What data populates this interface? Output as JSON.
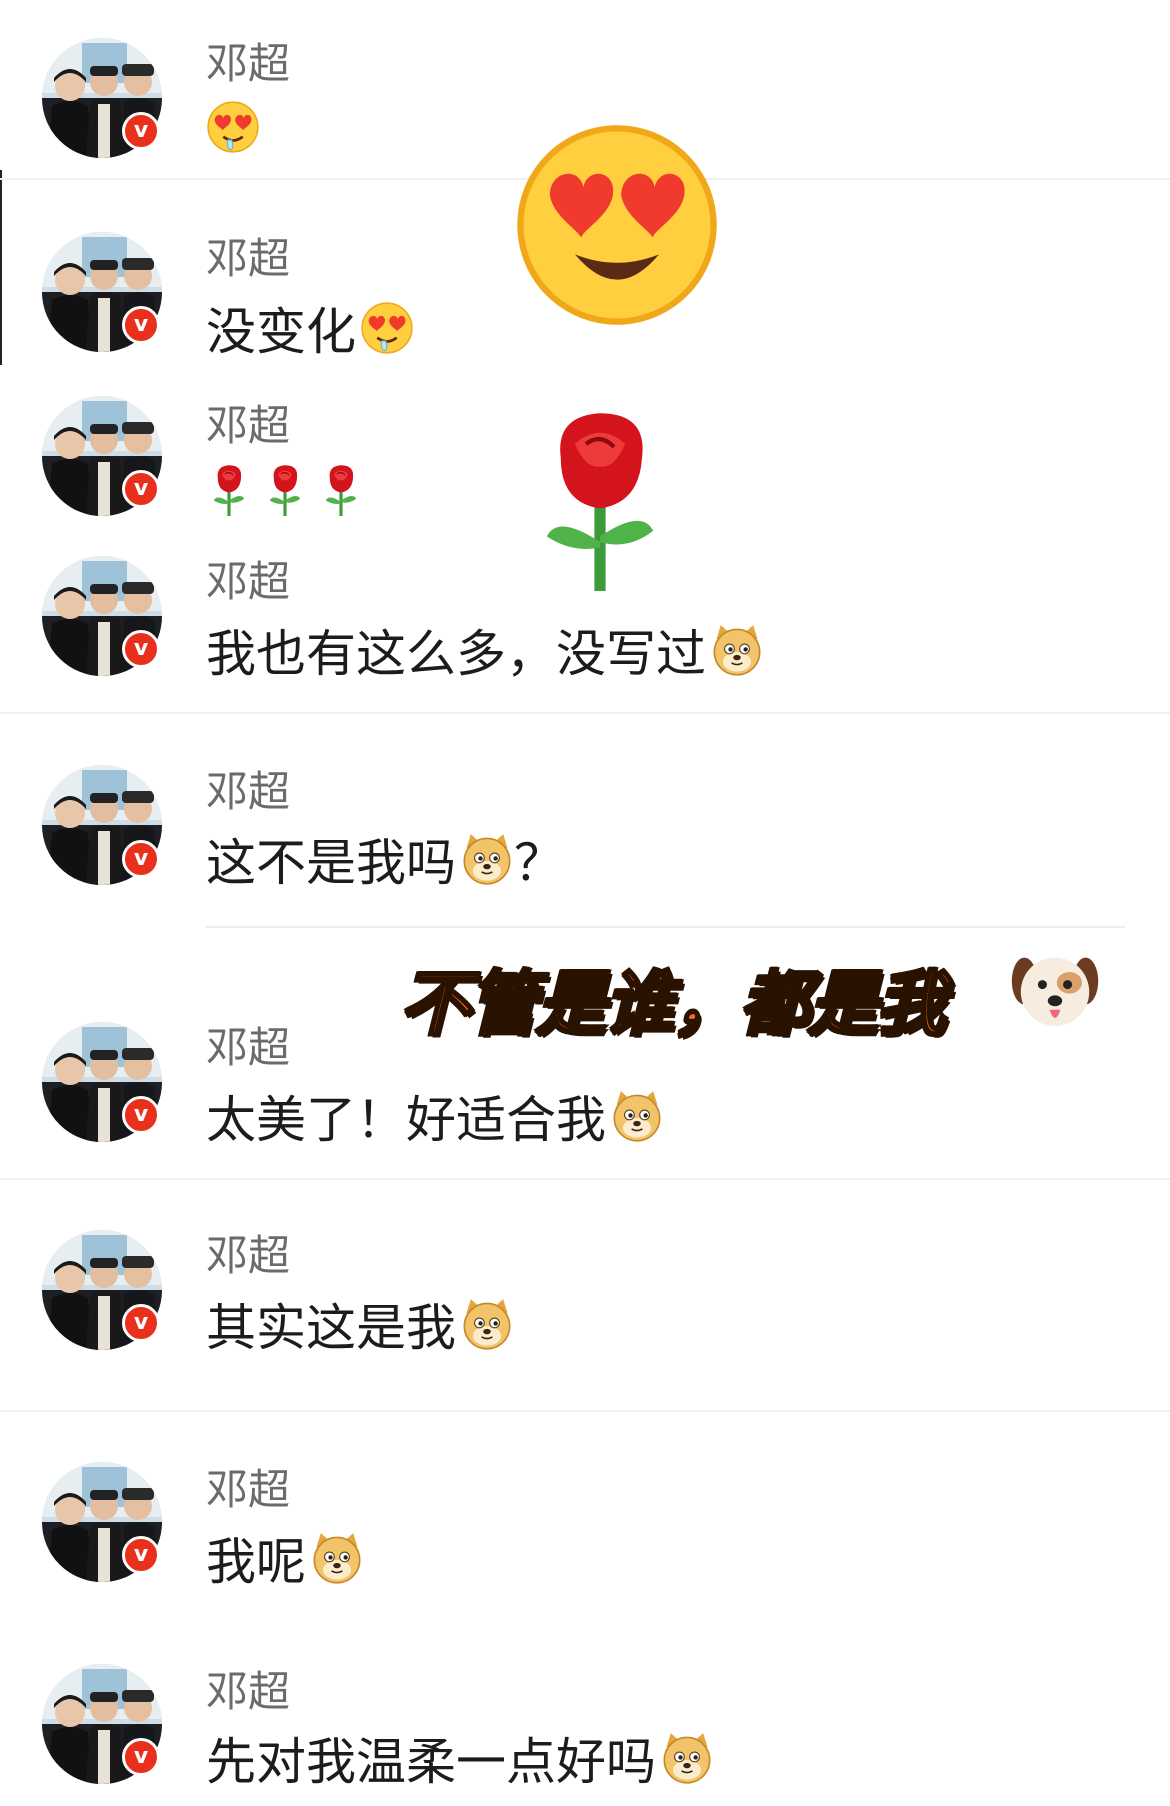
{
  "comments": [
    {
      "name": "邓超",
      "text": "",
      "emojis": [
        "heart-eyes-drool"
      ]
    },
    {
      "name": "邓超",
      "text": "没变化",
      "emojis": [
        "heart-eyes-drool"
      ]
    },
    {
      "name": "邓超",
      "text": "",
      "emojis": [
        "rose",
        "rose",
        "rose"
      ]
    },
    {
      "name": "邓超",
      "text": "我也有这么多，没写过",
      "emojis": [
        "doge"
      ]
    },
    {
      "name": "邓超",
      "text": "这不是我吗",
      "emojis": [
        "doge"
      ],
      "suffix": "？"
    },
    {
      "name": "邓超",
      "text": "太美了！好适合我",
      "emojis": [
        "doge"
      ]
    },
    {
      "name": "邓超",
      "text": "其实这是我",
      "emojis": [
        "doge"
      ]
    },
    {
      "name": "邓超",
      "text": "我呢",
      "emojis": [
        "doge"
      ]
    },
    {
      "name": "邓超",
      "text": "先对我温柔一点好吗",
      "emojis": [
        "doge"
      ]
    }
  ],
  "overlay": {
    "banner_text": "不管是谁，都是我",
    "stickers": [
      "heart-eyes-face",
      "rose",
      "puppy-face"
    ]
  },
  "colors": {
    "verified_badge": "#e8301c",
    "banner_fill": "#ff6a1a",
    "name_text": "#6b6b6b",
    "message_text": "#1c1c1c"
  },
  "badge_glyph": "v"
}
